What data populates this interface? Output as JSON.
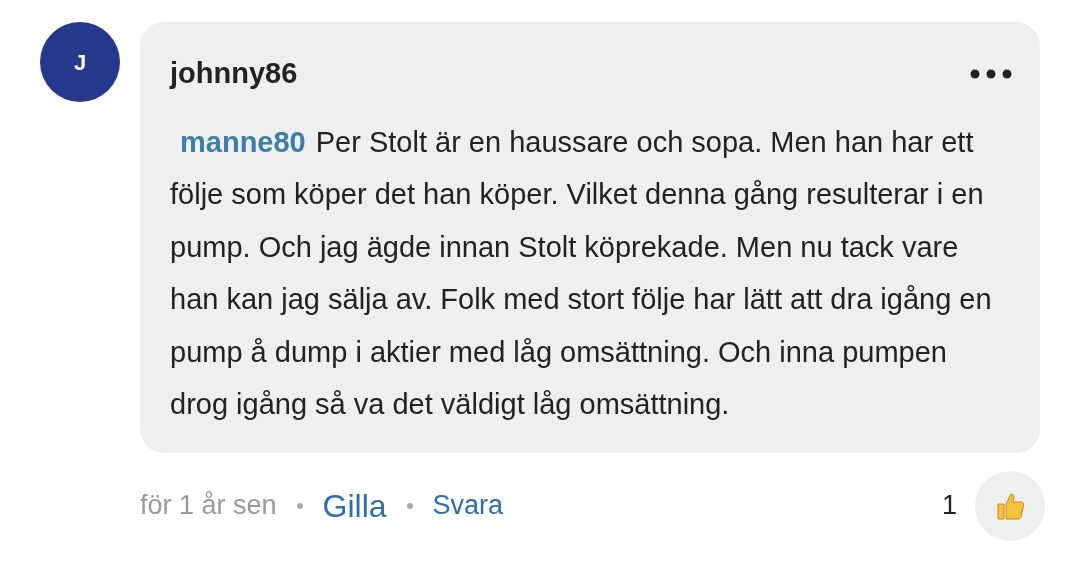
{
  "comment": {
    "avatar_initial": "J",
    "author": "johnny86",
    "mention": "manne80",
    "text": "Per Stolt är en haussare och sopa. Men han har ett följe som köper det han köper. Vilket denna gång resulterar i en pump. Och jag ägde innan Stolt köprekade. Men nu tack vare han kan jag sälja av. Folk med stort följe har lätt att dra igång en pump å dump i aktier med låg omsättning. Och inna pumpen drog igång så va det väldigt låg omsättning."
  },
  "footer": {
    "time": "för 1 år sen",
    "like": "Gilla",
    "reply": "Svara",
    "like_count": "1"
  }
}
